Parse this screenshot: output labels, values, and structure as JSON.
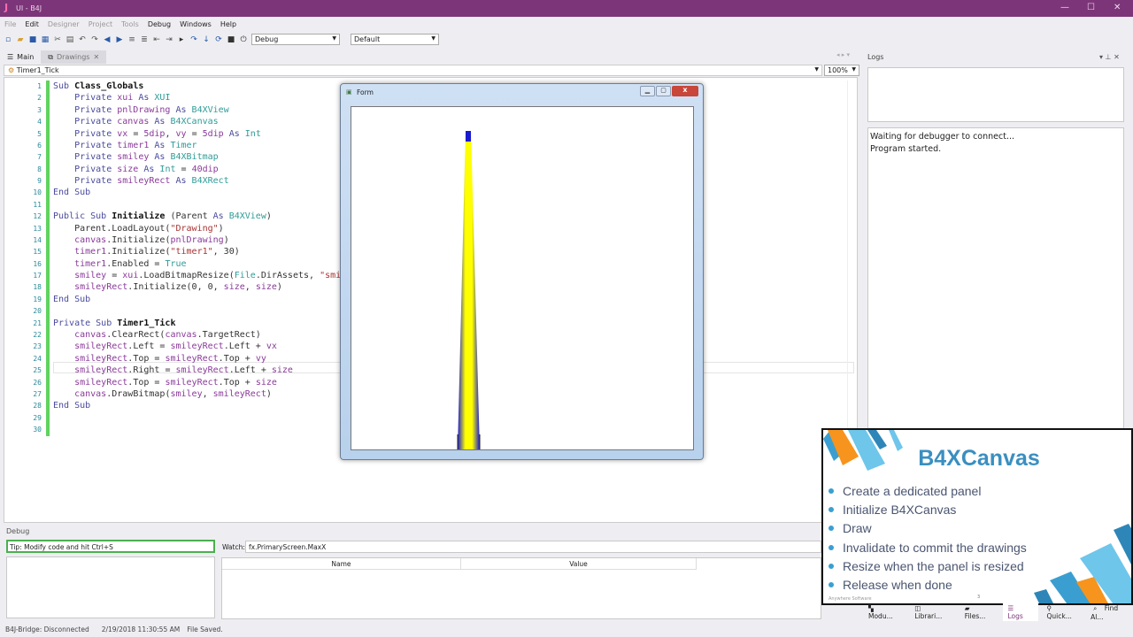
{
  "window": {
    "title": "UI - B4J"
  },
  "menu": [
    "File",
    "Edit",
    "Designer",
    "Project",
    "Tools",
    "Debug",
    "Windows",
    "Help"
  ],
  "menu_disabled": [
    true,
    false,
    true,
    true,
    true,
    false,
    false,
    false
  ],
  "toolbar": {
    "build_config": "Debug",
    "build_target": "Default"
  },
  "tabs": [
    {
      "label": "Main"
    },
    {
      "label": "Drawings"
    }
  ],
  "editor": {
    "sub_selector": "Timer1_Tick",
    "zoom": "100%",
    "lines": [
      [
        [
          "Sub ",
          "k"
        ],
        [
          "Class_Globals",
          "b"
        ]
      ],
      [
        [
          "    Private ",
          "k"
        ],
        [
          "xui ",
          "v"
        ],
        [
          "As ",
          "k"
        ],
        [
          "XUI",
          "ty"
        ]
      ],
      [
        [
          "    Private ",
          "k"
        ],
        [
          "pnlDrawing ",
          "v"
        ],
        [
          "As ",
          "k"
        ],
        [
          "B4XView",
          "ty"
        ]
      ],
      [
        [
          "    Private ",
          "k"
        ],
        [
          "canvas ",
          "v"
        ],
        [
          "As ",
          "k"
        ],
        [
          "B4XCanvas",
          "ty"
        ]
      ],
      [
        [
          "    Private ",
          "k"
        ],
        [
          "vx ",
          "v"
        ],
        [
          "= ",
          "p"
        ],
        [
          "5dip",
          "n"
        ],
        [
          ", ",
          "p"
        ],
        [
          "vy ",
          "v"
        ],
        [
          "= ",
          "p"
        ],
        [
          "5dip ",
          "n"
        ],
        [
          "As ",
          "k"
        ],
        [
          "Int",
          "ty"
        ]
      ],
      [
        [
          "    Private ",
          "k"
        ],
        [
          "timer1 ",
          "v"
        ],
        [
          "As ",
          "k"
        ],
        [
          "Timer",
          "ty"
        ]
      ],
      [
        [
          "    Private ",
          "k"
        ],
        [
          "smiley ",
          "v"
        ],
        [
          "As ",
          "k"
        ],
        [
          "B4XBitmap",
          "ty"
        ]
      ],
      [
        [
          "    Private ",
          "k"
        ],
        [
          "size ",
          "v"
        ],
        [
          "As ",
          "k"
        ],
        [
          "Int ",
          "ty"
        ],
        [
          "= ",
          "p"
        ],
        [
          "40dip",
          "n"
        ]
      ],
      [
        [
          "    Private ",
          "k"
        ],
        [
          "smileyRect ",
          "v"
        ],
        [
          "As ",
          "k"
        ],
        [
          "B4XRect",
          "ty"
        ]
      ],
      [
        [
          "End Sub",
          "k"
        ]
      ],
      [],
      [
        [
          "Public Sub ",
          "k"
        ],
        [
          "Initialize ",
          "b"
        ],
        [
          "(Parent ",
          "p"
        ],
        [
          "As ",
          "k"
        ],
        [
          "B4XView",
          "ty"
        ],
        [
          ")",
          "p"
        ]
      ],
      [
        [
          "    Parent.LoadLayout(",
          "p"
        ],
        [
          "\"Drawing\"",
          "s"
        ],
        [
          ")",
          "p"
        ]
      ],
      [
        [
          "    canvas",
          "v"
        ],
        [
          ".Initialize(",
          "p"
        ],
        [
          "pnlDrawing",
          "v"
        ],
        [
          ")",
          "p"
        ]
      ],
      [
        [
          "    timer1",
          "v"
        ],
        [
          ".Initialize(",
          "p"
        ],
        [
          "\"timer1\"",
          "s"
        ],
        [
          ", 30)",
          "p"
        ]
      ],
      [
        [
          "    timer1",
          "v"
        ],
        [
          ".Enabled = ",
          "p"
        ],
        [
          "True",
          "ty"
        ]
      ],
      [
        [
          "    smiley ",
          "v"
        ],
        [
          "= ",
          "p"
        ],
        [
          "xui",
          "v"
        ],
        [
          ".LoadBitmapResize(",
          "p"
        ],
        [
          "File",
          "ty"
        ],
        [
          ".DirAssets, ",
          "p"
        ],
        [
          "\"smi",
          "s"
        ]
      ],
      [
        [
          "    smileyRect",
          "v"
        ],
        [
          ".Initialize(0, 0, ",
          "p"
        ],
        [
          "size",
          "v"
        ],
        [
          ", ",
          "p"
        ],
        [
          "size",
          "v"
        ],
        [
          ")",
          "p"
        ]
      ],
      [
        [
          "End Sub",
          "k"
        ]
      ],
      [],
      [
        [
          "Private Sub ",
          "k"
        ],
        [
          "Timer1_Tick",
          "b"
        ]
      ],
      [
        [
          "    canvas",
          "v"
        ],
        [
          ".ClearRect(",
          "p"
        ],
        [
          "canvas",
          "v"
        ],
        [
          ".TargetRect)",
          "p"
        ]
      ],
      [
        [
          "    smileyRect",
          "v"
        ],
        [
          ".Left = ",
          "p"
        ],
        [
          "smileyRect",
          "v"
        ],
        [
          ".Left + ",
          "p"
        ],
        [
          "vx",
          "v"
        ]
      ],
      [
        [
          "    smileyRect",
          "v"
        ],
        [
          ".Top = ",
          "p"
        ],
        [
          "smileyRect",
          "v"
        ],
        [
          ".Top + ",
          "p"
        ],
        [
          "vy",
          "v"
        ]
      ],
      [
        [
          "    smileyRect",
          "v"
        ],
        [
          ".Right = ",
          "p"
        ],
        [
          "smileyRect",
          "v"
        ],
        [
          ".Left + ",
          "p"
        ],
        [
          "size",
          "v"
        ]
      ],
      [
        [
          "    smileyRect",
          "v"
        ],
        [
          ".Top = ",
          "p"
        ],
        [
          "smileyRect",
          "v"
        ],
        [
          ".Top + ",
          "p"
        ],
        [
          "size",
          "v"
        ]
      ],
      [
        [
          "    canvas",
          "v"
        ],
        [
          ".DrawBitmap(",
          "p"
        ],
        [
          "smiley",
          "v"
        ],
        [
          ", ",
          "p"
        ],
        [
          "smileyRect",
          "v"
        ],
        [
          ")",
          "p"
        ]
      ],
      [
        [
          "End Sub",
          "k"
        ]
      ],
      [],
      []
    ]
  },
  "form": {
    "title": "Form"
  },
  "logs": {
    "title": "Logs",
    "lines": [
      "Waiting for debugger to connect...",
      "Program started."
    ]
  },
  "debug": {
    "title": "Debug",
    "tip": "Tip: Modify code and hit Ctrl+S",
    "watch_label": "Watch:",
    "watch_value": "fx.PrimaryScreen.MaxX",
    "col_name": "Name",
    "col_value": "Value"
  },
  "status": {
    "bridge": "B4J-Bridge: Disconnected",
    "timestamp": "2/19/2018 11:30:55 AM",
    "message": "File Saved."
  },
  "bottom_tabs": [
    "Modu...",
    "Librari...",
    "Files...",
    "Logs",
    "Quick...",
    "Find Al..."
  ],
  "slide": {
    "title": "B4XCanvas",
    "bullets": [
      "Create a dedicated panel",
      "Initialize B4XCanvas",
      "Draw",
      "Invalidate to commit the drawings",
      "Resize when the panel is resized",
      "Release when done"
    ],
    "footer": "Anywhere Software",
    "page": "3",
    "colors": {
      "title": "#3a8fc0",
      "accent_orange": "#f7941d",
      "accent_blue": "#6ec6ea"
    }
  },
  "colors": {
    "titlebar": "#7d3579",
    "modified_bar": "#5fd35f"
  }
}
